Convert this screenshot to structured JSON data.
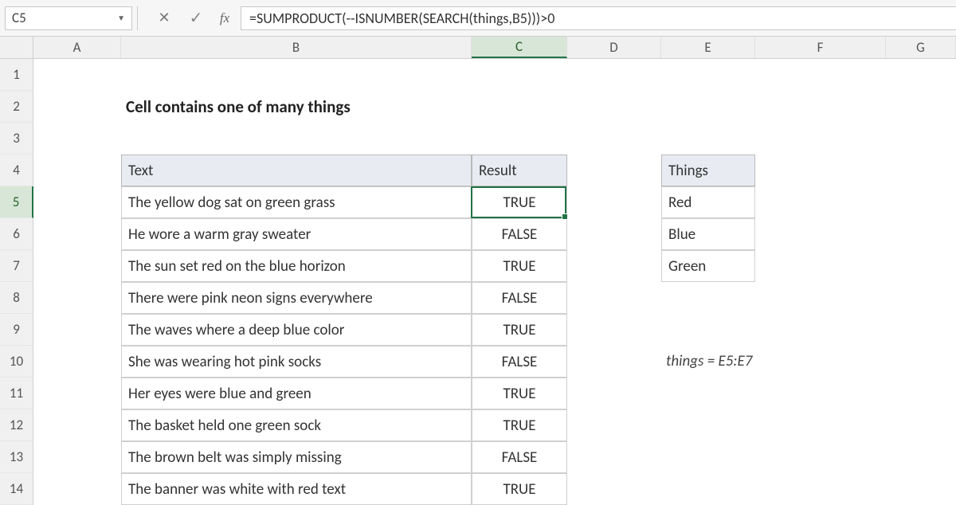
{
  "name_box": "C5",
  "formula": "=SUMPRODUCT(--ISNUMBER(SEARCH(things,B5)))>0",
  "columns": [
    "A",
    "B",
    "C",
    "D",
    "E",
    "F",
    "G"
  ],
  "active_col": "C",
  "active_row": 5,
  "title": "Cell contains one of many things",
  "table": {
    "headers": {
      "text": "Text",
      "result": "Result"
    },
    "rows": [
      {
        "text": "The yellow dog sat on green grass",
        "result": "TRUE"
      },
      {
        "text": "He wore a warm gray sweater",
        "result": "FALSE"
      },
      {
        "text": "The sun set red on the blue horizon",
        "result": "TRUE"
      },
      {
        "text": "There were pink neon signs everywhere",
        "result": "FALSE"
      },
      {
        "text": "The waves where a deep blue color",
        "result": "TRUE"
      },
      {
        "text": "She was wearing hot pink socks",
        "result": "FALSE"
      },
      {
        "text": "Her eyes were blue and green",
        "result": "TRUE"
      },
      {
        "text": "The basket held one green sock",
        "result": "TRUE"
      },
      {
        "text": "The brown belt was simply missing",
        "result": "FALSE"
      },
      {
        "text": "The banner was white with red text",
        "result": "TRUE"
      }
    ]
  },
  "things": {
    "header": "Things",
    "items": [
      "Red",
      "Blue",
      "Green"
    ]
  },
  "annotation": "things = E5:E7",
  "icons": {
    "cancel": "✕",
    "enter": "✓",
    "fx": "fx",
    "dropdown": "▼"
  }
}
